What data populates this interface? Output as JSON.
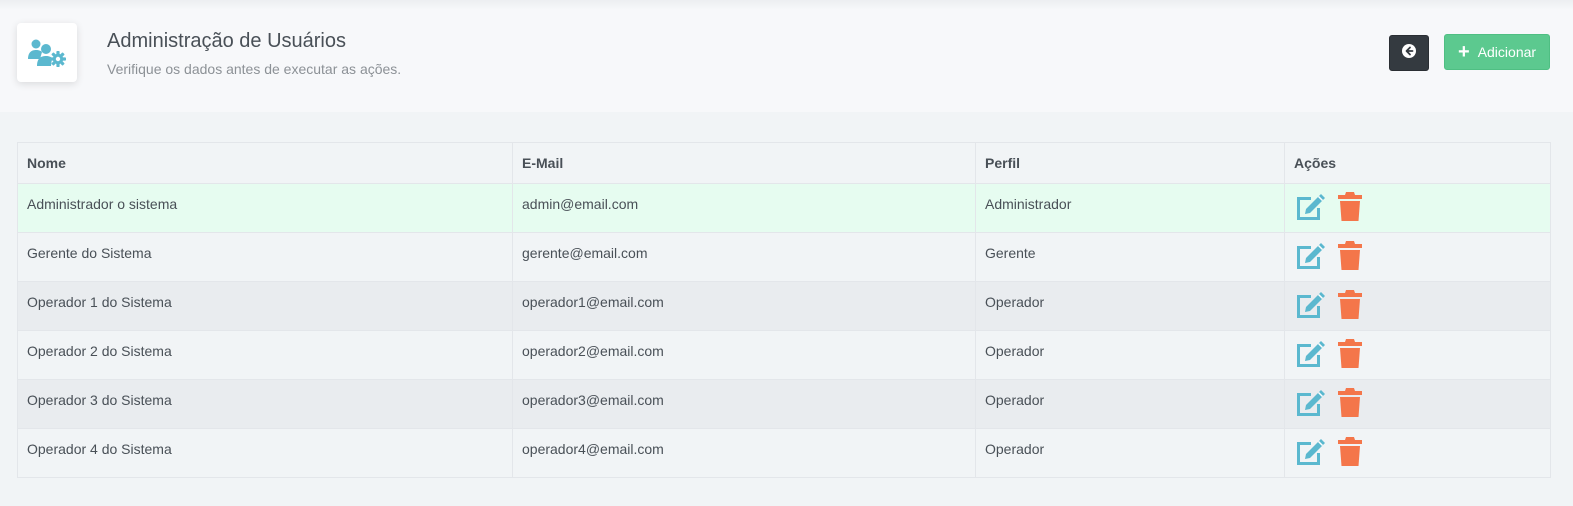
{
  "header": {
    "title": "Administração de Usuários",
    "subtitle": "Verifique os dados antes de executar as ações.",
    "icon": "users-cog-icon",
    "back_icon": "arrow-circle-left-icon",
    "add_label": "Adicionar",
    "add_icon": "plus-icon"
  },
  "colors": {
    "accent_icon": "#5bb8cf",
    "delete": "#f4764a",
    "add_button": "#5cc98f",
    "back_button": "#343a40",
    "hover_row": "#e6fcf0"
  },
  "table": {
    "columns": [
      "Nome",
      "E-Mail",
      "Perfil",
      "Ações"
    ],
    "rows": [
      {
        "name": "Administrador o sistema",
        "email": "admin@email.com",
        "profile": "Administrador"
      },
      {
        "name": "Gerente do Sistema",
        "email": "gerente@email.com",
        "profile": "Gerente"
      },
      {
        "name": "Operador 1 do Sistema",
        "email": "operador1@email.com",
        "profile": "Operador"
      },
      {
        "name": "Operador 2 do Sistema",
        "email": "operador2@email.com",
        "profile": "Operador"
      },
      {
        "name": "Operador 3 do Sistema",
        "email": "operador3@email.com",
        "profile": "Operador"
      },
      {
        "name": "Operador 4 do Sistema",
        "email": "operador4@email.com",
        "profile": "Operador"
      }
    ],
    "action_icons": [
      "edit-icon",
      "trash-icon"
    ]
  }
}
